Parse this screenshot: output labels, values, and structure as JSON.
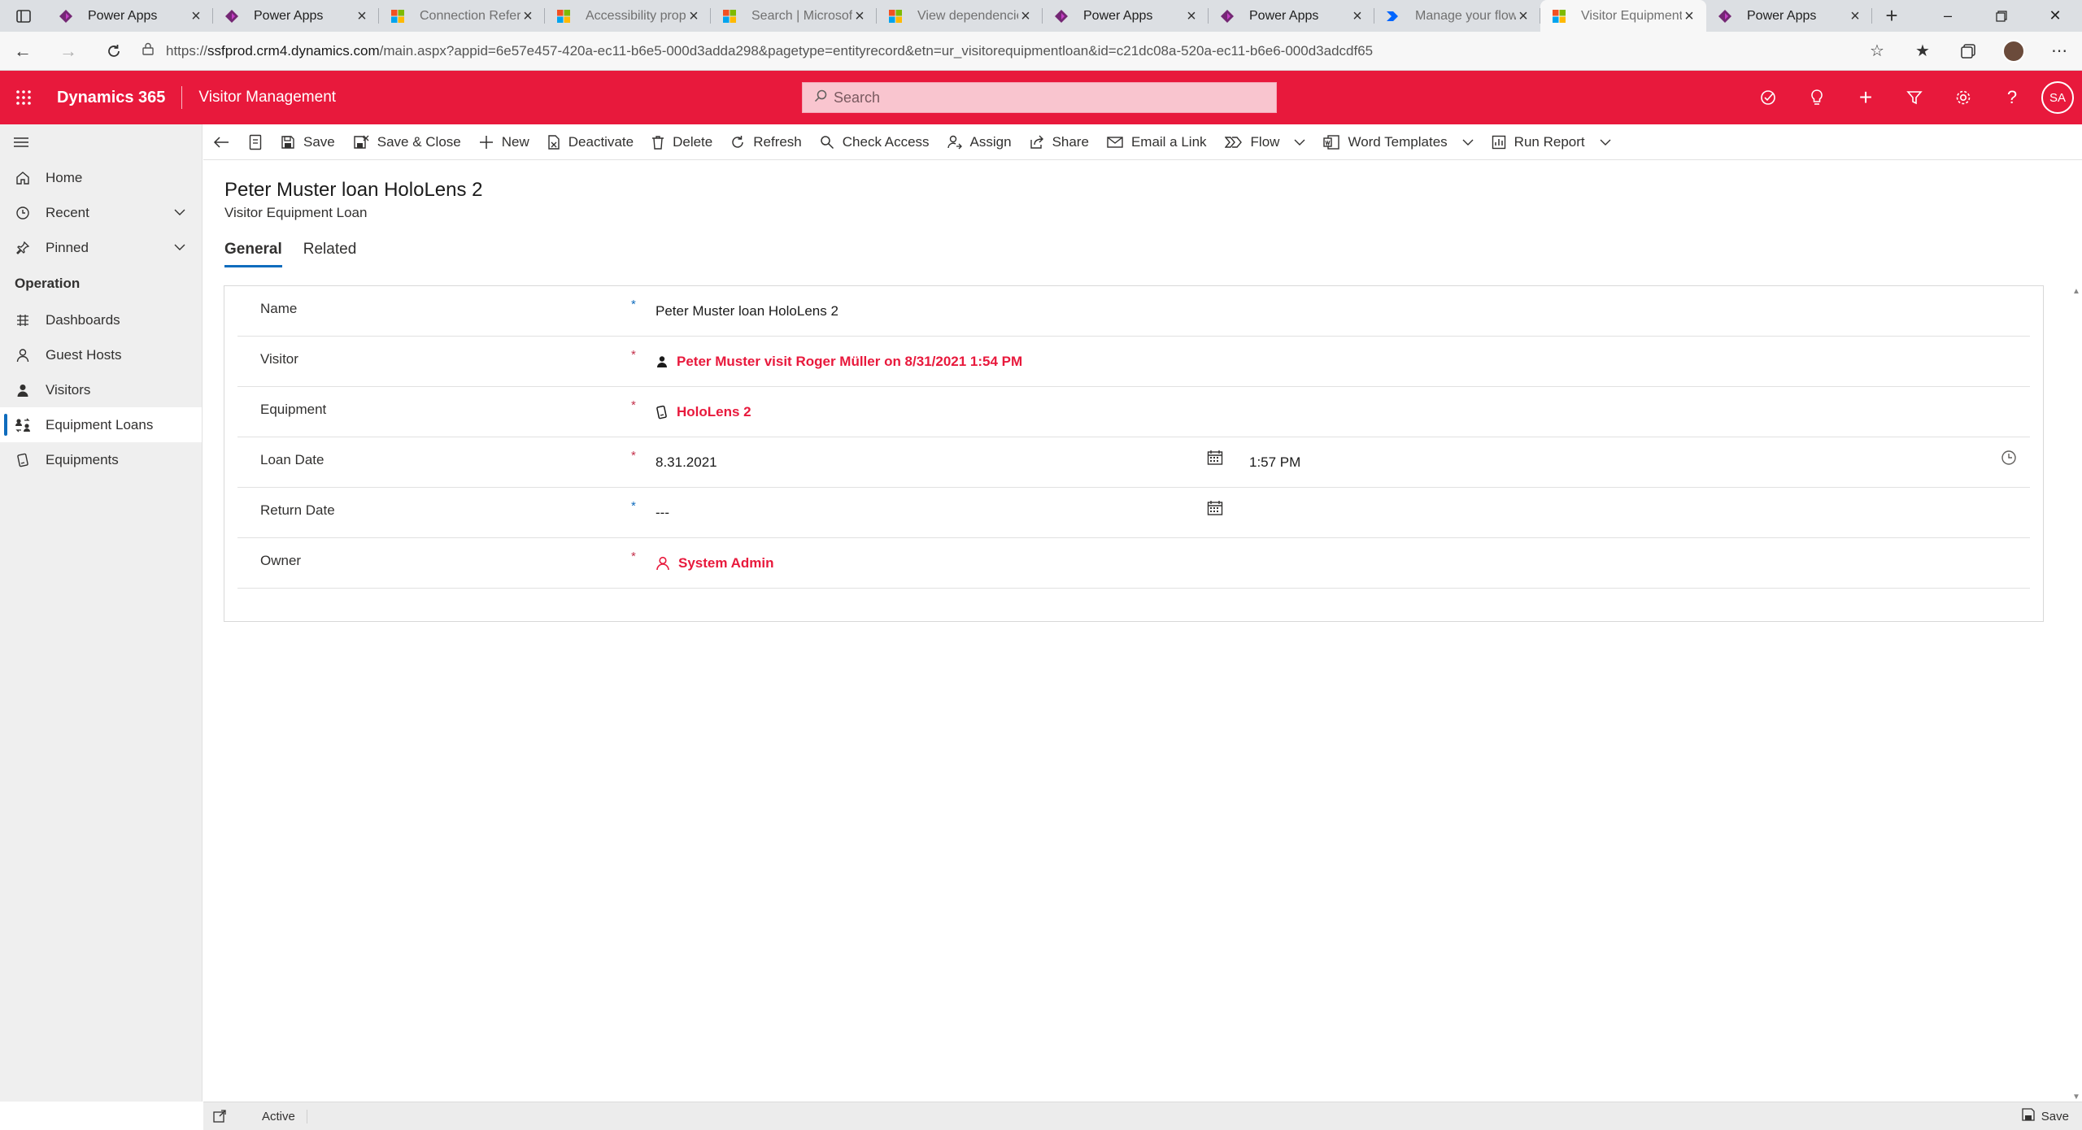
{
  "browser": {
    "tabs": [
      {
        "title": "Power Apps",
        "icon": "power-apps-icon",
        "active": false
      },
      {
        "title": "Power Apps",
        "icon": "power-apps-icon",
        "active": false
      },
      {
        "title": "Connection Refere",
        "icon": "microsoft-logo-icon",
        "active": false
      },
      {
        "title": "Accessibility prope",
        "icon": "microsoft-logo-icon",
        "active": false
      },
      {
        "title": "Search | Microsoft",
        "icon": "microsoft-logo-icon",
        "active": false
      },
      {
        "title": "View dependencie",
        "icon": "microsoft-logo-icon",
        "active": false
      },
      {
        "title": "Power Apps",
        "icon": "power-apps-icon",
        "active": false
      },
      {
        "title": "Power Apps",
        "icon": "power-apps-icon",
        "active": false
      },
      {
        "title": "Manage your flow",
        "icon": "power-automate-icon",
        "active": false
      },
      {
        "title": "Visitor Equipment",
        "icon": "microsoft-logo-icon",
        "active": true
      },
      {
        "title": "Power Apps",
        "icon": "power-apps-icon",
        "active": false
      }
    ],
    "url": {
      "prefix": "https://",
      "domain": "ssfprod.crm4.dynamics.com",
      "path": "/main.aspx?appid=6e57e457-420a-ec11-b6e5-000d3adda298&pagetype=entityrecord&etn=ur_visitorequipmentloan&id=c21dc08a-520a-ec11-b6e6-000d3adcdf65"
    }
  },
  "app": {
    "brand": "Dynamics 365",
    "name": "Visitor Management",
    "search_placeholder": "Search",
    "user_initials": "SA",
    "accent_color": "#e8193c"
  },
  "nav": {
    "items_top": [
      {
        "label": "Home",
        "icon": "home-icon"
      },
      {
        "label": "Recent",
        "icon": "clock-icon",
        "expandable": true
      },
      {
        "label": "Pinned",
        "icon": "pin-icon",
        "expandable": true
      }
    ],
    "group_label": "Operation",
    "items": [
      {
        "label": "Dashboards",
        "icon": "dashboard-icon",
        "selected": false
      },
      {
        "label": "Guest Hosts",
        "icon": "person-icon",
        "selected": false
      },
      {
        "label": "Visitors",
        "icon": "person-filled-icon",
        "selected": false
      },
      {
        "label": "Equipment Loans",
        "icon": "people-swap-icon",
        "selected": true
      },
      {
        "label": "Equipments",
        "icon": "device-icon",
        "selected": false
      }
    ]
  },
  "commands": {
    "save": "Save",
    "save_close": "Save & Close",
    "new": "New",
    "deactivate": "Deactivate",
    "delete": "Delete",
    "refresh": "Refresh",
    "check_access": "Check Access",
    "assign": "Assign",
    "share": "Share",
    "email_link": "Email a Link",
    "flow": "Flow",
    "word_templates": "Word Templates",
    "run_report": "Run Report"
  },
  "record": {
    "title": "Peter Muster loan HoloLens 2",
    "entity": "Visitor Equipment Loan",
    "tabs": [
      "General",
      "Related"
    ]
  },
  "form": {
    "name": {
      "label": "Name",
      "value": "Peter Muster loan HoloLens 2"
    },
    "visitor": {
      "label": "Visitor",
      "value": "Peter Muster visit Roger Müller on 8/31/2021 1:54 PM"
    },
    "equipment": {
      "label": "Equipment",
      "value": "HoloLens 2"
    },
    "loan_date": {
      "label": "Loan Date",
      "date": "8.31.2021",
      "time": "1:57 PM"
    },
    "return_date": {
      "label": "Return Date",
      "date": "---"
    },
    "owner": {
      "label": "Owner",
      "value": "System Admin"
    },
    "required_mark": "*"
  },
  "status": {
    "state": "Active",
    "save": "Save"
  }
}
